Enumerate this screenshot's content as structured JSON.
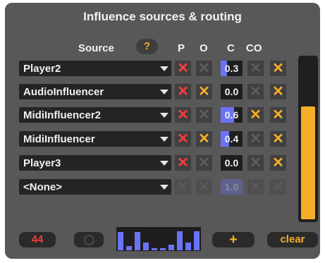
{
  "title": "Influence sources & routing",
  "headers": {
    "source": "Source",
    "help": "?",
    "p": "P",
    "o": "O",
    "c": "C",
    "co": "CO"
  },
  "rows": [
    {
      "source": "Player2",
      "p": true,
      "o": false,
      "c": "0.3",
      "c_level": 0.3,
      "co": false,
      "co2": true,
      "disabled": false
    },
    {
      "source": "AudioInfluencer",
      "p": true,
      "o": true,
      "c": "0.0",
      "c_level": 0.0,
      "co": false,
      "co2": true,
      "disabled": false
    },
    {
      "source": "MidiInfluencer2",
      "p": true,
      "o": false,
      "c": "0.6",
      "c_level": 0.6,
      "co": true,
      "co2": true,
      "disabled": false
    },
    {
      "source": "MidiInfluencer",
      "p": true,
      "o": true,
      "c": "0.4",
      "c_level": 0.4,
      "co": false,
      "co2": true,
      "disabled": false
    },
    {
      "source": "Player3",
      "p": true,
      "o": false,
      "c": "0.0",
      "c_level": 0.0,
      "co": false,
      "co2": true,
      "disabled": false
    },
    {
      "source": "<None>",
      "p": false,
      "o": false,
      "c": "1.0",
      "c_level": 1.0,
      "co": false,
      "co2": false,
      "disabled": true
    }
  ],
  "meter_level": 0.7,
  "count": "44",
  "histogram": [
    0.85,
    0.2,
    0.85,
    0.35,
    0.1,
    0.1,
    0.25,
    0.9,
    0.35,
    0.9
  ],
  "buttons": {
    "plus": "+",
    "clear": "clear"
  },
  "colors": {
    "accent": "#f6ad2a",
    "red": "#ff3b3b",
    "blue": "#6a73f5",
    "panel": "#585858"
  }
}
